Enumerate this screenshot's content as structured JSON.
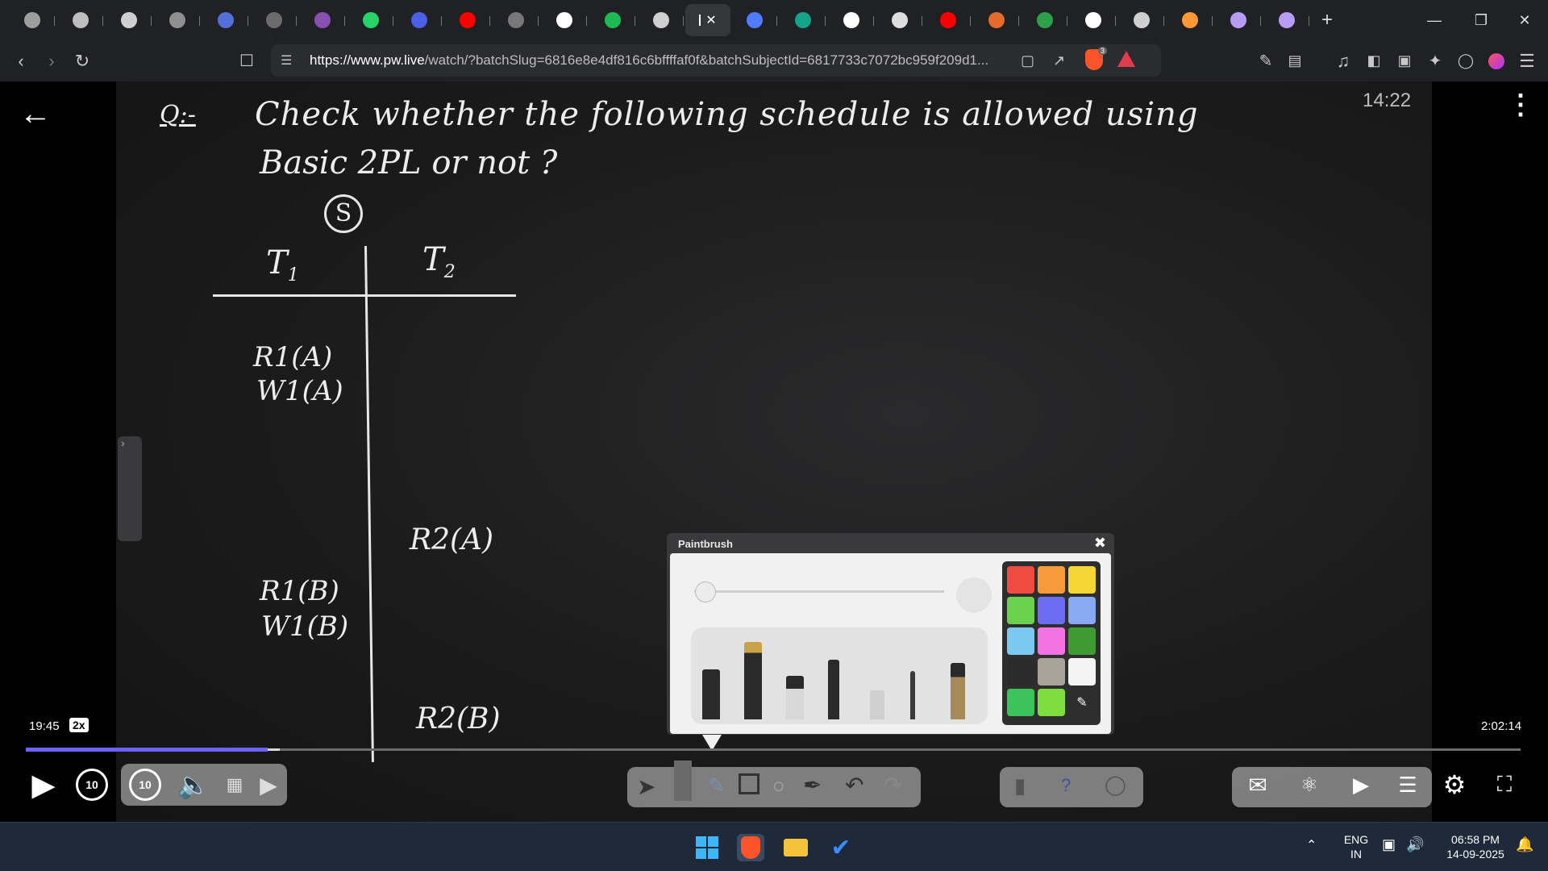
{
  "browser": {
    "tabs": [
      {
        "icon": "generic-tab-icon",
        "color": "#9e9e9e"
      },
      {
        "icon": "ai-tab-icon",
        "color": "#bdbdbd"
      },
      {
        "icon": "web-tab-icon",
        "color": "#cfcfcf"
      },
      {
        "icon": "web-tab-icon",
        "color": "#8f8f8f"
      },
      {
        "icon": "web-tab-icon",
        "color": "#5470d8"
      },
      {
        "icon": "web-tab-icon",
        "color": "#6b6b6b"
      },
      {
        "icon": "avatar-tab-icon",
        "color": "#8a4fb2"
      },
      {
        "icon": "whatsapp-icon",
        "color": "#25d366"
      },
      {
        "icon": "bookmark-tab-icon",
        "color": "#4b5ee8"
      },
      {
        "icon": "youtube-icon",
        "color": "#ff0000"
      },
      {
        "icon": "web-tab-icon",
        "color": "#777777"
      },
      {
        "icon": "google-icon",
        "color": "#ffffff"
      },
      {
        "icon": "spotify-icon",
        "color": "#1db954"
      },
      {
        "icon": "web-tab-icon",
        "color": "#cfcfcf"
      },
      {
        "icon": "active-tab-icon",
        "color": "#ffffff",
        "active": true
      },
      {
        "icon": "gemini-icon",
        "color": "#4f7cff"
      },
      {
        "icon": "web-tab-icon",
        "color": "#13a38a"
      },
      {
        "icon": "google-icon",
        "color": "#ffffff"
      },
      {
        "icon": "window-tab-icon",
        "color": "#dddddd"
      },
      {
        "icon": "youtube-icon",
        "color": "#ff0000"
      },
      {
        "icon": "web-tab-icon",
        "color": "#e56b2a"
      },
      {
        "icon": "web-tab-icon",
        "color": "#2fa04a"
      },
      {
        "icon": "wikipedia-icon",
        "color": "#ffffff"
      },
      {
        "icon": "web-tab-icon",
        "color": "#cfcfcf"
      },
      {
        "icon": "india-flag-icon",
        "color": "#ff9933"
      },
      {
        "icon": "web-tab-icon",
        "color": "#b69cf2"
      },
      {
        "icon": "web-tab-icon",
        "color": "#b69cf2"
      }
    ],
    "address": {
      "host": "https://www.pw.live",
      "path": "/watch/?batchSlug=6816e8e4df816c6bffffaf0f&batchSubjectId=6817733c7072bc959f209d1..."
    },
    "shield_count": "3"
  },
  "board": {
    "question_prefix": "Q:-",
    "question_line1": "Check  whether   the  following  schedule  is  allowed  using",
    "question_line2": "Basic 2PL  or  not ?",
    "schedule_label": "S",
    "t1": "T",
    "t1_sub": "1",
    "t2": "T",
    "t2_sub": "2",
    "ops": {
      "r1a": "R1(A)",
      "w1a": "W1(A)",
      "r2a": "R2(A)",
      "r1b": "R1(B)",
      "w1b": "W1(B)",
      "r2b": "R2(B)"
    }
  },
  "paintbrush": {
    "title": "Paintbrush",
    "colors": [
      "#ef4b3f",
      "#f79b3a",
      "#f7d534",
      "#6ad24e",
      "#6b6cf0",
      "#8aa9f4",
      "#7bc8f0",
      "#f472e2",
      "#3e9b33",
      "#2b2b2b",
      "#a8a49a",
      "#f4f4f4",
      "#3cc45a",
      "#7edc3e",
      "#2e2e2e"
    ]
  },
  "player": {
    "clock": "14:22",
    "current_time": "19:45",
    "speed": "2x",
    "duration": "2:02:14",
    "progress_fraction": 0.162,
    "buffered_fraction": 0.17,
    "skip_seconds": "10"
  },
  "taskbar": {
    "lang_top": "ENG",
    "lang_bottom": "IN",
    "time": "06:58 PM",
    "date": "14-09-2025"
  }
}
